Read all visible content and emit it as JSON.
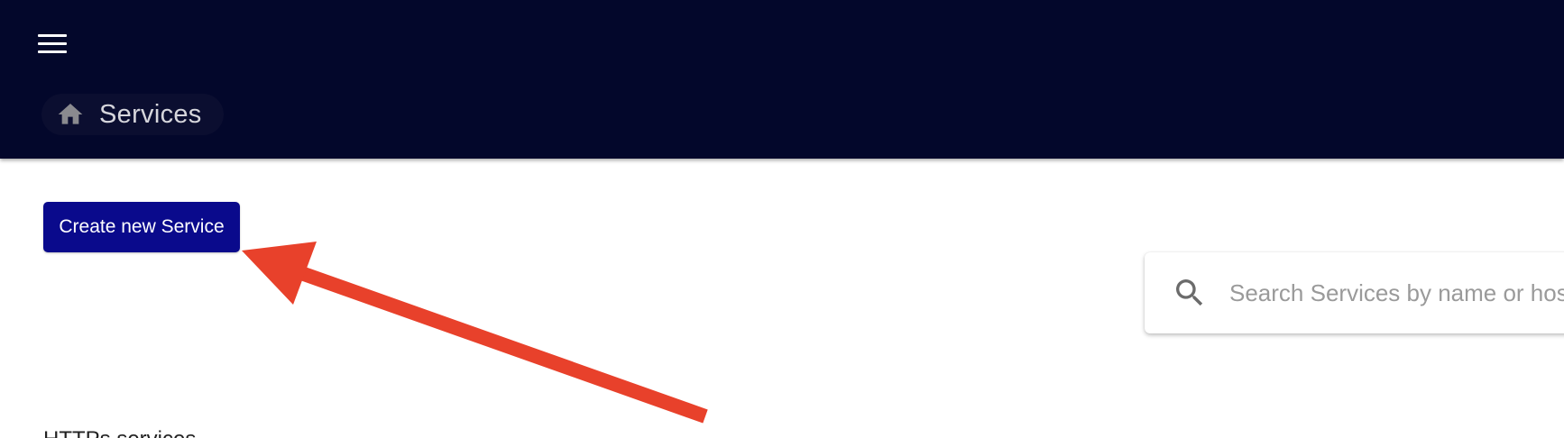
{
  "appbar": {
    "menu_icon": "hamburger-menu-icon",
    "breadcrumb": {
      "icon": "home-icon",
      "label": "Services"
    }
  },
  "actions": {
    "create_label": "Create new Service"
  },
  "search": {
    "icon": "search-icon",
    "placeholder": "Search Services by name or hos"
  },
  "sections": {
    "https_heading": "HTTPs services"
  },
  "annotation": {
    "type": "arrow",
    "color": "#e8412b",
    "points_to": "create-new-service-button"
  },
  "colors": {
    "appbar_bg": "#03072b",
    "primary_button": "#0a0a8c",
    "annotation": "#e8412b"
  }
}
